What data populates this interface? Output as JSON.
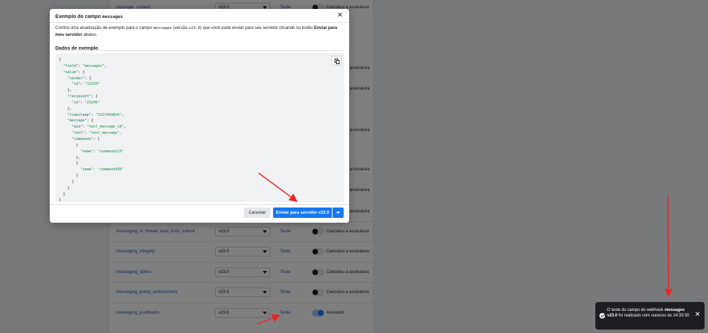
{
  "background": {
    "rows": [
      {
        "name": "message_context",
        "version": "v23.0",
        "test": "Teste",
        "subscribed": false,
        "status": "Cancelou a assinatura"
      },
      {
        "name": "messaging_in_thread_lead_form_submit",
        "version": "v23.0",
        "test": "Teste",
        "subscribed": false,
        "status": "Cancelou a assinatura"
      },
      {
        "name": "messaging_integrity",
        "version": "v23.0",
        "test": "Teste",
        "subscribed": false,
        "status": "Cancelou a assinatura"
      },
      {
        "name": "messaging_optins",
        "version": "v23.0",
        "test": "Teste",
        "subscribed": false,
        "status": "Cancelou a assinatura"
      },
      {
        "name": "messaging_policy_enforcement",
        "version": "v23.0",
        "test": "Teste",
        "subscribed": false,
        "status": "Cancelou a assinatura"
      },
      {
        "name": "messaging_postbacks",
        "version": "v23.0",
        "test": "Teste",
        "subscribed": true,
        "status": "Assinado"
      }
    ],
    "partial_status_label": "assinatura"
  },
  "modal": {
    "title_prefix": "Exemplo do campo ",
    "title_field": "messages",
    "desc_part1": "Confira uma atualização de exemplo para o campo ",
    "desc_field": "messages",
    "desc_part2": " (versão ",
    "desc_version": "v23.0",
    "desc_part3": ") que você pode enviar para seu servidor clicando no botão ",
    "desc_bold": "Enviar para meu servidor",
    "desc_part4": " abaixo.",
    "section_title": "Dados de exemplo",
    "code_lines": [
      "{",
      "  \"field\": \"messages\",",
      "  \"value\": {",
      "    \"sender\": {",
      "      \"id\": \"12334\"",
      "    },",
      "    \"recipient\": {",
      "      \"id\": \"23245\"",
      "    },",
      "    \"timestamp\": \"1527459824\",",
      "    \"message\": {",
      "      \"mid\": \"test_message_id\",",
      "      \"text\": \"test_message\",",
      "      \"commands\": [",
      "        {",
      "          \"name\": \"command123\"",
      "        },",
      "        {",
      "          \"name\": \"command456\"",
      "        }",
      "      ]",
      "    }",
      "  }",
      "}"
    ],
    "cancel_label": "Cancelar",
    "send_label": "Enviar para servidor v23.0"
  },
  "toast": {
    "part1": "O teste do campo de webhook ",
    "bold1": "messages",
    "bold2": "v23.0",
    "part2": " foi realizado com sucesso às",
    "time": "14:33:30"
  },
  "colors": {
    "accent": "#1877f2",
    "link": "#1d5bbf",
    "annotation_arrow": "#e8262a"
  }
}
